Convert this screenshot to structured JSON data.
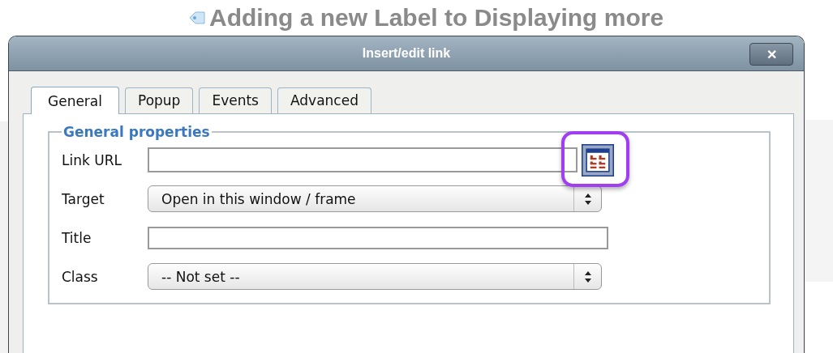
{
  "page_heading": "Adding a new Label to Displaying more",
  "dialog": {
    "title": "Insert/edit link",
    "close": "✕",
    "tabs": [
      {
        "label": "General",
        "selected": true
      },
      {
        "label": "Popup",
        "selected": false
      },
      {
        "label": "Events",
        "selected": false
      },
      {
        "label": "Advanced",
        "selected": false
      }
    ],
    "fieldset": {
      "legend": "General properties",
      "fields": [
        {
          "kind": "text",
          "label": "Link URL",
          "browse": {
            "highlighted": true
          }
        },
        {
          "kind": "select",
          "label": "Target",
          "value": "Open in this window / frame"
        },
        {
          "kind": "text",
          "label": "Title"
        },
        {
          "kind": "select",
          "label": "Class",
          "value": "-- Not set --"
        }
      ]
    }
  }
}
